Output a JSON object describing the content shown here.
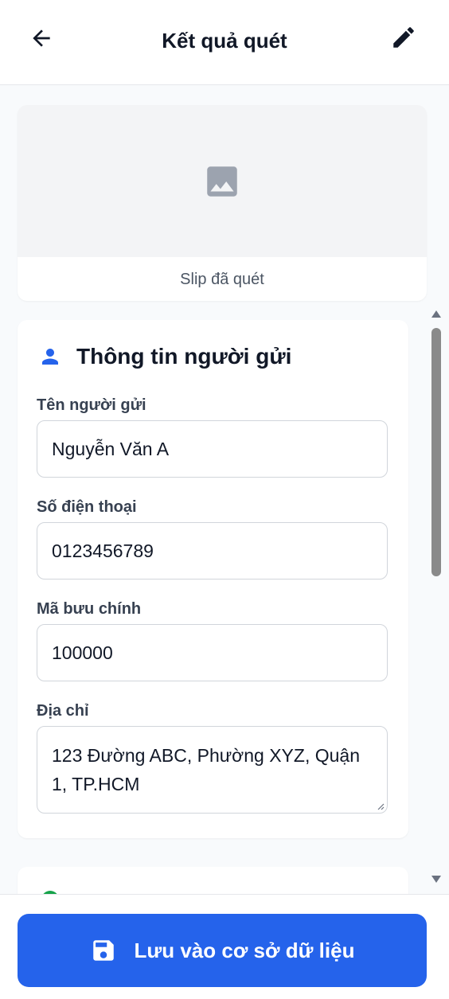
{
  "header": {
    "title": "Kết quả quét",
    "back_icon": "arrow-left-icon",
    "edit_icon": "pencil-icon"
  },
  "scan_preview": {
    "icon": "image-icon",
    "caption": "Slip đã quét"
  },
  "sender_section": {
    "icon": "person-icon",
    "title": "Thông tin người gửi",
    "fields": [
      {
        "label": "Tên người gửi",
        "value": "Nguyễn Văn A"
      },
      {
        "label": "Số điện thoại",
        "value": "0123456789"
      },
      {
        "label": "Mã bưu chính",
        "value": "100000"
      },
      {
        "label": "Địa chỉ",
        "value": "123 Đường ABC, Phường XYZ, Quận 1, TP.HCM"
      }
    ]
  },
  "footer": {
    "save_label": "Lưu vào cơ sở dữ liệu",
    "save_icon": "floppy-disk-icon"
  },
  "colors": {
    "primary": "#2563eb",
    "section_icon": "#2563eb",
    "next_section_icon": "#16a34a",
    "background": "#f8fafc"
  }
}
